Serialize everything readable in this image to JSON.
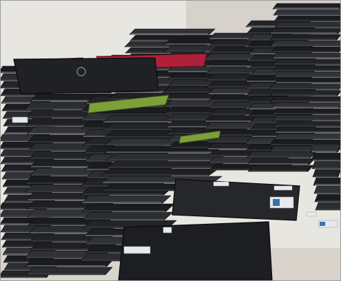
{
  "scene": {
    "subject": "laptop-stacks",
    "colors": {
      "wall": "#e8e6e1",
      "wall_shadow": "#cfcbc4",
      "floor": "#d8d4cc",
      "laptop_dark": "#1b1c1f",
      "laptop_mid": "#2b2d31",
      "laptop_edge": "#4a4d53",
      "laptop_silver": "#8d9197",
      "accent_red": "#b0203a",
      "accent_green": "#7da03a",
      "sticker": "#e6e9ee",
      "sticker_blue": "#3a6fb0"
    }
  }
}
